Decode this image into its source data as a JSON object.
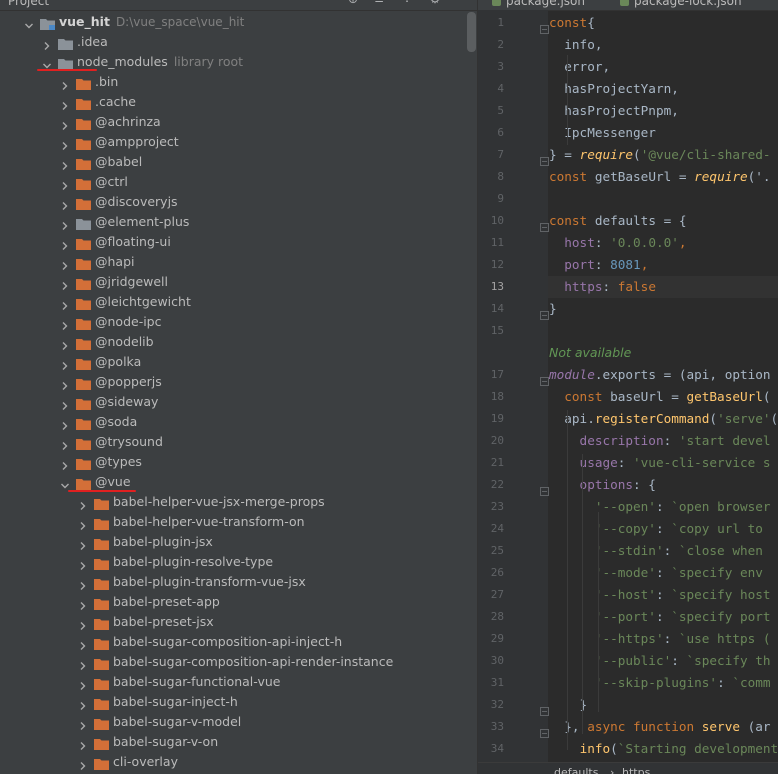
{
  "project_panel": {
    "header_title": "Project",
    "root": {
      "name": "vue_hit",
      "path": "D:\\vue_space\\vue_hit"
    },
    "rows": [
      {
        "label": "vue_hit",
        "depth": 0,
        "expanded": true,
        "folder": "module",
        "path": "D:\\vue_space\\vue_hit"
      },
      {
        "label": ".idea",
        "depth": 1,
        "expanded": false,
        "folder": "gray"
      },
      {
        "label": "node_modules",
        "depth": 1,
        "expanded": true,
        "folder": "gray",
        "hint": "library root"
      },
      {
        "label": ".bin",
        "depth": 2,
        "expanded": false,
        "folder": "orange"
      },
      {
        "label": ".cache",
        "depth": 2,
        "expanded": false,
        "folder": "orange"
      },
      {
        "label": "@achrinza",
        "depth": 2,
        "expanded": false,
        "folder": "orange"
      },
      {
        "label": "@ampproject",
        "depth": 2,
        "expanded": false,
        "folder": "orange"
      },
      {
        "label": "@babel",
        "depth": 2,
        "expanded": false,
        "folder": "orange"
      },
      {
        "label": "@ctrl",
        "depth": 2,
        "expanded": false,
        "folder": "orange"
      },
      {
        "label": "@discoveryjs",
        "depth": 2,
        "expanded": false,
        "folder": "orange"
      },
      {
        "label": "@element-plus",
        "depth": 2,
        "expanded": false,
        "folder": "gray"
      },
      {
        "label": "@floating-ui",
        "depth": 2,
        "expanded": false,
        "folder": "orange"
      },
      {
        "label": "@hapi",
        "depth": 2,
        "expanded": false,
        "folder": "orange"
      },
      {
        "label": "@jridgewell",
        "depth": 2,
        "expanded": false,
        "folder": "orange"
      },
      {
        "label": "@leichtgewicht",
        "depth": 2,
        "expanded": false,
        "folder": "orange"
      },
      {
        "label": "@node-ipc",
        "depth": 2,
        "expanded": false,
        "folder": "orange"
      },
      {
        "label": "@nodelib",
        "depth": 2,
        "expanded": false,
        "folder": "orange"
      },
      {
        "label": "@polka",
        "depth": 2,
        "expanded": false,
        "folder": "orange"
      },
      {
        "label": "@popperjs",
        "depth": 2,
        "expanded": false,
        "folder": "orange"
      },
      {
        "label": "@sideway",
        "depth": 2,
        "expanded": false,
        "folder": "orange"
      },
      {
        "label": "@soda",
        "depth": 2,
        "expanded": false,
        "folder": "orange"
      },
      {
        "label": "@trysound",
        "depth": 2,
        "expanded": false,
        "folder": "orange"
      },
      {
        "label": "@types",
        "depth": 2,
        "expanded": false,
        "folder": "orange"
      },
      {
        "label": "@vue",
        "depth": 2,
        "expanded": true,
        "folder": "orange"
      },
      {
        "label": "babel-helper-vue-jsx-merge-props",
        "depth": 3,
        "expanded": false,
        "folder": "orange"
      },
      {
        "label": "babel-helper-vue-transform-on",
        "depth": 3,
        "expanded": false,
        "folder": "orange"
      },
      {
        "label": "babel-plugin-jsx",
        "depth": 3,
        "expanded": false,
        "folder": "orange"
      },
      {
        "label": "babel-plugin-resolve-type",
        "depth": 3,
        "expanded": false,
        "folder": "orange"
      },
      {
        "label": "babel-plugin-transform-vue-jsx",
        "depth": 3,
        "expanded": false,
        "folder": "orange"
      },
      {
        "label": "babel-preset-app",
        "depth": 3,
        "expanded": false,
        "folder": "orange"
      },
      {
        "label": "babel-preset-jsx",
        "depth": 3,
        "expanded": false,
        "folder": "orange"
      },
      {
        "label": "babel-sugar-composition-api-inject-h",
        "depth": 3,
        "expanded": false,
        "folder": "orange"
      },
      {
        "label": "babel-sugar-composition-api-render-instance",
        "depth": 3,
        "expanded": false,
        "folder": "orange"
      },
      {
        "label": "babel-sugar-functional-vue",
        "depth": 3,
        "expanded": false,
        "folder": "orange"
      },
      {
        "label": "babel-sugar-inject-h",
        "depth": 3,
        "expanded": false,
        "folder": "orange"
      },
      {
        "label": "babel-sugar-v-model",
        "depth": 3,
        "expanded": false,
        "folder": "orange"
      },
      {
        "label": "babel-sugar-v-on",
        "depth": 3,
        "expanded": false,
        "folder": "orange"
      },
      {
        "label": "cli-overlay",
        "depth": 3,
        "expanded": false,
        "folder": "orange"
      }
    ]
  },
  "editor": {
    "tabs": [
      "package.json",
      "package-lock.json"
    ],
    "current_line": 13,
    "lines": [
      {
        "num": "1",
        "tokens": [
          [
            "kw",
            "const"
          ],
          [
            "",
            "{"
          ]
        ]
      },
      {
        "num": "2",
        "tokens": [
          [
            "",
            "  info,"
          ]
        ]
      },
      {
        "num": "3",
        "tokens": [
          [
            "",
            "  error,"
          ]
        ]
      },
      {
        "num": "4",
        "tokens": [
          [
            "",
            "  hasProjectYarn,"
          ]
        ]
      },
      {
        "num": "5",
        "tokens": [
          [
            "",
            "  hasProjectPnpm,"
          ]
        ]
      },
      {
        "num": "6",
        "tokens": [
          [
            "",
            "  IpcMessenger"
          ]
        ]
      },
      {
        "num": "7",
        "tokens": [
          [
            "",
            "} = "
          ],
          [
            "req",
            "require"
          ],
          [
            "",
            "("
          ],
          [
            "str",
            "'@vue/cli-shared-"
          ]
        ]
      },
      {
        "num": "8",
        "tokens": [
          [
            "kw",
            "const "
          ],
          [
            "",
            "getBaseUrl = "
          ],
          [
            "req",
            "require"
          ],
          [
            "",
            "('."
          ]
        ]
      },
      {
        "num": "9",
        "tokens": []
      },
      {
        "num": "10",
        "tokens": [
          [
            "kw",
            "const "
          ],
          [
            "",
            "defaults = {"
          ]
        ]
      },
      {
        "num": "11",
        "tokens": [
          [
            "prop",
            "  host"
          ],
          [
            "",
            ": "
          ],
          [
            "str",
            "'0.0.0.0'"
          ],
          [
            "kw",
            ","
          ]
        ]
      },
      {
        "num": "12",
        "tokens": [
          [
            "prop",
            "  port"
          ],
          [
            "",
            ": "
          ],
          [
            "num",
            "8081"
          ],
          [
            "kw",
            ","
          ]
        ]
      },
      {
        "num": "13",
        "tokens": [
          [
            "prop",
            "  https"
          ],
          [
            "",
            ": "
          ],
          [
            "kw",
            "false"
          ]
        ]
      },
      {
        "num": "14",
        "tokens": [
          [
            "",
            "}"
          ]
        ]
      },
      {
        "num": "15",
        "tokens": []
      },
      {
        "num": "",
        "tokens": [
          [
            "hint-na",
            "Not available"
          ]
        ]
      },
      {
        "num": "17",
        "tokens": [
          [
            "mod",
            "module"
          ],
          [
            "",
            ".exports = (api, option"
          ]
        ]
      },
      {
        "num": "18",
        "tokens": [
          [
            "kw",
            "  const "
          ],
          [
            "",
            "baseUrl = "
          ],
          [
            "fn",
            "getBaseUrl"
          ],
          [
            "",
            "("
          ]
        ]
      },
      {
        "num": "19",
        "tokens": [
          [
            "",
            "  api."
          ],
          [
            "fn",
            "registerCommand"
          ],
          [
            "",
            "("
          ],
          [
            "str",
            "'serve'"
          ],
          [
            "",
            "("
          ]
        ]
      },
      {
        "num": "20",
        "tokens": [
          [
            "prop",
            "    description"
          ],
          [
            "",
            ": "
          ],
          [
            "str",
            "'start devel"
          ]
        ]
      },
      {
        "num": "21",
        "tokens": [
          [
            "prop",
            "    usage"
          ],
          [
            "",
            ": "
          ],
          [
            "str",
            "'vue-cli-service s"
          ]
        ]
      },
      {
        "num": "22",
        "tokens": [
          [
            "prop",
            "    options"
          ],
          [
            "",
            ": {"
          ]
        ]
      },
      {
        "num": "23",
        "tokens": [
          [
            "str",
            "      '--open'"
          ],
          [
            "",
            ": "
          ],
          [
            "str",
            "`open browser"
          ]
        ]
      },
      {
        "num": "24",
        "tokens": [
          [
            "str",
            "      '--copy'"
          ],
          [
            "",
            ": "
          ],
          [
            "str",
            "`copy url to"
          ]
        ]
      },
      {
        "num": "25",
        "tokens": [
          [
            "str",
            "      '--stdin'"
          ],
          [
            "",
            ": "
          ],
          [
            "str",
            "`close when"
          ]
        ]
      },
      {
        "num": "26",
        "tokens": [
          [
            "str",
            "      '--mode'"
          ],
          [
            "",
            ": "
          ],
          [
            "str",
            "`specify env"
          ]
        ]
      },
      {
        "num": "27",
        "tokens": [
          [
            "str",
            "      '--host'"
          ],
          [
            "",
            ": "
          ],
          [
            "str",
            "`specify host"
          ]
        ]
      },
      {
        "num": "28",
        "tokens": [
          [
            "str",
            "      '--port'"
          ],
          [
            "",
            ": "
          ],
          [
            "str",
            "`specify port"
          ]
        ]
      },
      {
        "num": "29",
        "tokens": [
          [
            "str",
            "      '--https'"
          ],
          [
            "",
            ": "
          ],
          [
            "str",
            "`use https ("
          ]
        ]
      },
      {
        "num": "30",
        "tokens": [
          [
            "str",
            "      '--public'"
          ],
          [
            "",
            ": "
          ],
          [
            "str",
            "`specify th"
          ]
        ]
      },
      {
        "num": "31",
        "tokens": [
          [
            "str",
            "      '--skip-plugins'"
          ],
          [
            "",
            ": "
          ],
          [
            "str",
            "`comm"
          ]
        ]
      },
      {
        "num": "32",
        "tokens": [
          [
            "",
            "    }"
          ]
        ]
      },
      {
        "num": "33",
        "tokens": [
          [
            "",
            "  }, "
          ],
          [
            "kw",
            "async function "
          ],
          [
            "fn",
            "serve "
          ],
          [
            "",
            "(ar"
          ]
        ]
      },
      {
        "num": "34",
        "tokens": [
          [
            "",
            "    "
          ],
          [
            "fn",
            "info"
          ],
          [
            "",
            "("
          ],
          [
            "str",
            "`Starting development"
          ]
        ]
      }
    ],
    "breadcrumb": [
      "defaults",
      "https"
    ]
  },
  "colors": {
    "panel_bg": "#3c3f41",
    "editor_bg": "#2b2b2b",
    "folder_orange": "#d36f38",
    "folder_gray": "#8b9299",
    "annotation_red": "#e02020"
  }
}
